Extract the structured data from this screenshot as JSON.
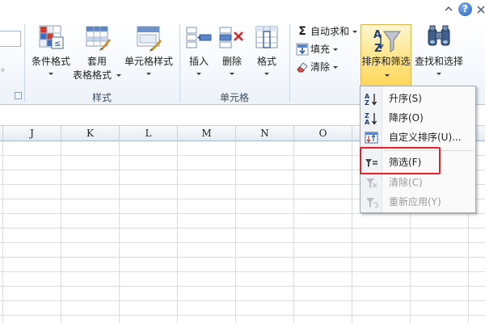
{
  "colors": {
    "accent_highlight": "#e8202a",
    "active_button": "#ffd75a"
  },
  "titlebar": {
    "collapse_icon": "chevron-up-icon",
    "help_label": "?",
    "close_icon": "close-icon"
  },
  "ribbon": {
    "stub_partial_label": "◦",
    "styles_group": {
      "label": "样式",
      "conditional_format": {
        "label": "条件格式",
        "icon": "conditional-format-icon"
      },
      "table_format": {
        "label_line1": "套用",
        "label_line2": "表格格式",
        "icon": "table-format-icon"
      },
      "cell_styles": {
        "label": "单元格样式",
        "icon": "cell-styles-icon"
      }
    },
    "cells_group": {
      "label": "单元格",
      "insert": {
        "label": "插入",
        "icon": "insert-cells-icon"
      },
      "delete": {
        "label": "删除",
        "icon": "delete-cells-icon"
      },
      "format": {
        "label": "格式",
        "icon": "format-cells-icon"
      }
    },
    "editing_group": {
      "autosum": {
        "label": "自动求和",
        "icon": "sigma-icon"
      },
      "fill": {
        "label": "填充",
        "icon": "fill-down-icon"
      },
      "clear": {
        "label": "清除",
        "icon": "eraser-icon"
      },
      "sort_filter": {
        "label": "排序和筛选",
        "icon": "sort-filter-icon"
      },
      "find_select": {
        "label": "查找和选择",
        "icon": "binoculars-icon"
      }
    }
  },
  "grid": {
    "columns": [
      "J",
      "K",
      "L",
      "M",
      "N",
      "O"
    ]
  },
  "sort_menu": {
    "items": [
      {
        "label": "升序(S)",
        "icon": "sort-ascending-icon",
        "enabled": true
      },
      {
        "label": "降序(O)",
        "icon": "sort-descending-icon",
        "enabled": true
      },
      {
        "label": "自定义排序(U)...",
        "icon": "custom-sort-icon",
        "enabled": true
      },
      {
        "label": "筛选(F)",
        "icon": "filter-icon",
        "enabled": true
      },
      {
        "label": "清除(C)",
        "icon": "clear-filter-icon",
        "enabled": false
      },
      {
        "label": "重新应用(Y)",
        "icon": "reapply-filter-icon",
        "enabled": false
      }
    ]
  }
}
